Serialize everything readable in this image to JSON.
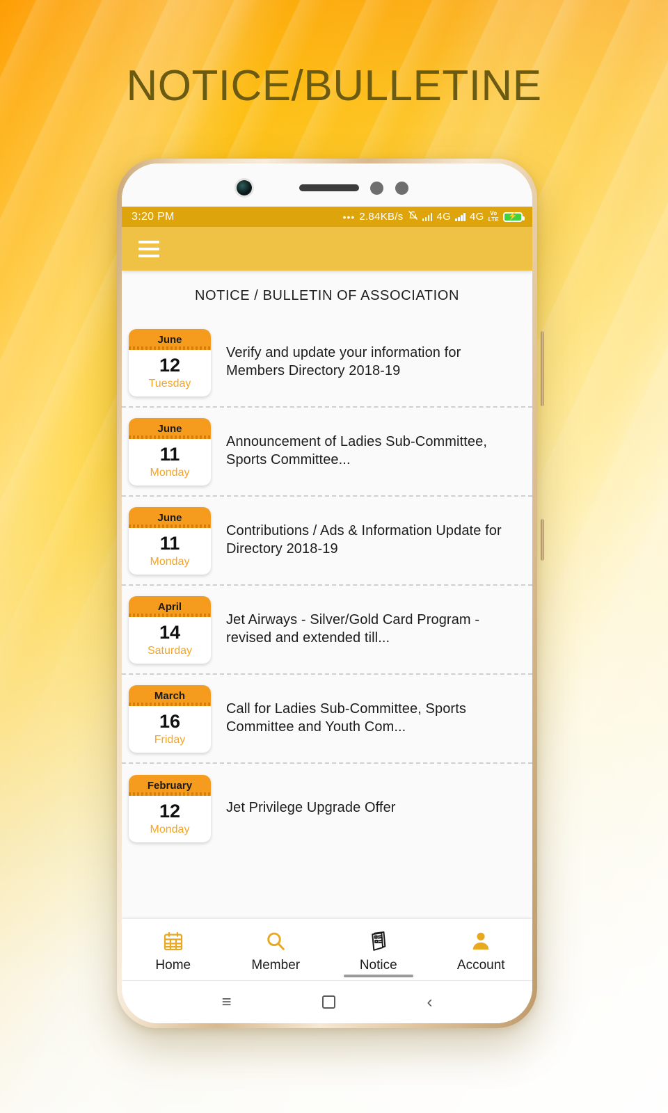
{
  "banner": {
    "title": "NOTICE/BULLETINE",
    "title_color": "#6B5A12"
  },
  "phone": {
    "status_bar": {
      "time": "3:20 PM",
      "dots": "•••",
      "network_speed": "2.84KB/s",
      "silent_icon": "bell-muted-icon",
      "sim1_network": "4G",
      "sim2_network": "4G",
      "volte_top": "Vo",
      "volte_bottom": "LTE",
      "battery_state": "charging",
      "bg_color": "#DDA40C"
    },
    "app_bar": {
      "menu_icon": "hamburger-menu-icon",
      "bg_color": "#EFC245"
    },
    "screen_title": "NOTICE / BULLETIN OF ASSOCIATION",
    "notices": [
      {
        "month": "June",
        "day": "12",
        "weekday": "Tuesday",
        "text": "Verify and update your information for Members Directory 2018-19"
      },
      {
        "month": "June",
        "day": "11",
        "weekday": "Monday",
        "text": "Announcement of Ladies Sub-Committee, Sports Committee..."
      },
      {
        "month": "June",
        "day": "11",
        "weekday": "Monday",
        "text": "Contributions / Ads & Information Update for Directory 2018-19"
      },
      {
        "month": "April",
        "day": "14",
        "weekday": "Saturday",
        "text": "Jet Airways - Silver/Gold Card Program - revised and extended till..."
      },
      {
        "month": "March",
        "day": "16",
        "weekday": "Friday",
        "text": "Call for Ladies Sub-Committee, Sports Committee and Youth Com..."
      },
      {
        "month": "February",
        "day": "12",
        "weekday": "Monday",
        "text": "Jet Privilege Upgrade Offer"
      }
    ],
    "bottom_nav": [
      {
        "label": "Home",
        "icon": "calendar-icon",
        "active": false
      },
      {
        "label": "Member",
        "icon": "magnifier-icon",
        "active": false
      },
      {
        "label": "Notice",
        "icon": "document-list-icon",
        "active": true
      },
      {
        "label": "Account",
        "icon": "person-icon",
        "active": false
      }
    ],
    "android_nav": {
      "recents": "≡",
      "home": "home-square-icon",
      "back": "‹"
    },
    "colors": {
      "accent_orange": "#F59C1F",
      "accent_gold": "#E8A820",
      "weekday_text": "#F5A623"
    }
  }
}
